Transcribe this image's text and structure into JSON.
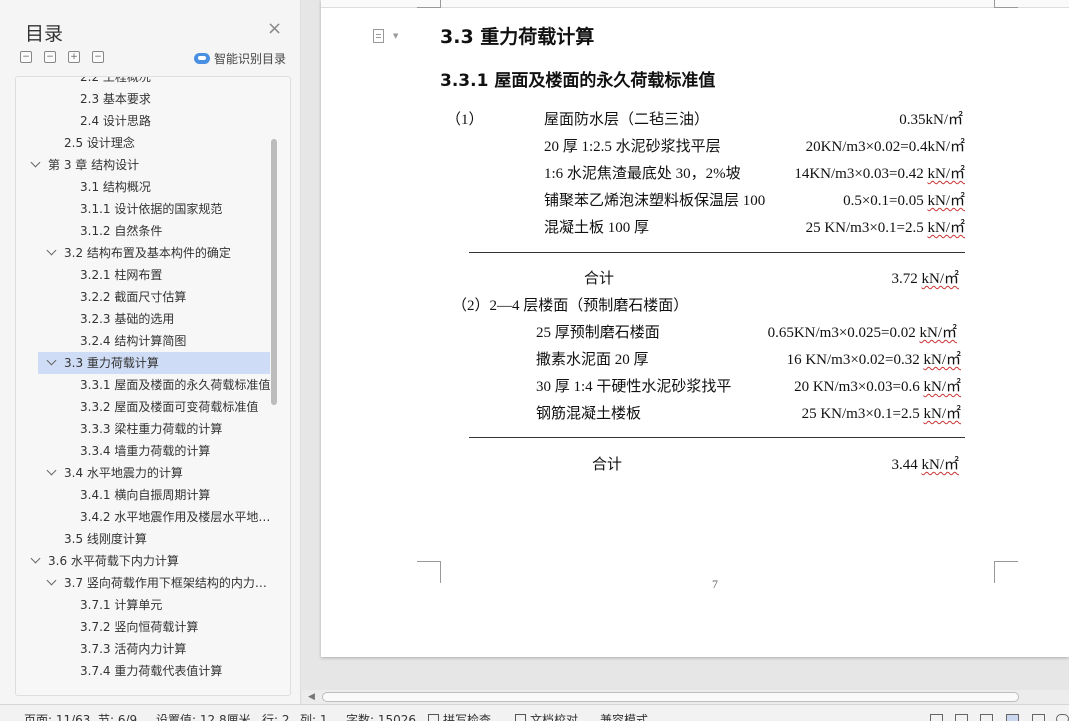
{
  "toc": {
    "title": "目录",
    "close_icon": "×",
    "toolbar": {
      "collapse_all": "−",
      "collapse": "−",
      "expand": "+",
      "expand_all": "−"
    },
    "smart_label": "智能识别目录",
    "items": [
      {
        "label": "2.2 工程概况",
        "level": 2,
        "caret": false
      },
      {
        "label": "2.3 基本要求",
        "level": 2,
        "caret": false
      },
      {
        "label": "2.4 设计思路",
        "level": 2,
        "caret": false
      },
      {
        "label": "2.5 设计理念",
        "level": 1,
        "caret": false
      },
      {
        "label": "第 3 章   结构设计",
        "level": 0,
        "caret": true
      },
      {
        "label": "3.1 结构概况",
        "level": 2,
        "caret": false
      },
      {
        "label": "3.1.1 设计依据的国家规范",
        "level": 2,
        "caret": false
      },
      {
        "label": "3.1.2 自然条件",
        "level": 2,
        "caret": false
      },
      {
        "label": "3.2 结构布置及基本构件的确定",
        "level": 1,
        "caret": true
      },
      {
        "label": "3.2.1 柱网布置",
        "level": 2,
        "caret": false
      },
      {
        "label": "3.2.2 截面尺寸估算",
        "level": 2,
        "caret": false
      },
      {
        "label": "3.2.3 基础的选用",
        "level": 2,
        "caret": false
      },
      {
        "label": "3.2.4 结构计算简图",
        "level": 2,
        "caret": false
      },
      {
        "label": "3.3 重力荷载计算",
        "level": 1,
        "caret": true,
        "selected": true
      },
      {
        "label": "3.3.1 屋面及楼面的永久荷载标准值",
        "level": 2,
        "caret": false
      },
      {
        "label": "3.3.2 屋面及楼面可变荷载标准值",
        "level": 2,
        "caret": false
      },
      {
        "label": "3.3.3 梁柱重力荷载的计算",
        "level": 2,
        "caret": false
      },
      {
        "label": "3.3.4 墙重力荷载的计算",
        "level": 2,
        "caret": false
      },
      {
        "label": "3.4 水平地震力的计算",
        "level": 1,
        "caret": true
      },
      {
        "label": "3.4.1 横向自振周期计算",
        "level": 2,
        "caret": false
      },
      {
        "label": "3.4.2 水平地震作用及楼层水平地震剪力计算",
        "level": 2,
        "caret": false
      },
      {
        "label": "3.5 线刚度计算",
        "level": 1,
        "caret": false
      },
      {
        "label": "3.6 水平荷载下内力计算",
        "level": 0,
        "caret": true
      },
      {
        "label": "3.7 竖向荷载作用下框架结构的内力计算",
        "level": 1,
        "caret": true
      },
      {
        "label": "3.7.1 计算单元",
        "level": 2,
        "caret": false
      },
      {
        "label": "3.7.2 竖向恒荷载计算",
        "level": 2,
        "caret": false
      },
      {
        "label": "3.7.3 活荷内力计算",
        "level": 2,
        "caret": false
      },
      {
        "label": "3.7.4 重力荷载代表值计算",
        "level": 2,
        "caret": false
      }
    ]
  },
  "doc": {
    "heading": "3.3 重力荷载计算",
    "subheading": "3.3.1 屋面及楼面的永久荷载标准值",
    "section1_label": "（1）",
    "roof_rows": [
      {
        "name": "屋面防水层（二毡三油）",
        "calc": "0.35kN/㎡",
        "unit": ""
      },
      {
        "name": "20 厚 1:2.5 水泥砂浆找平层",
        "calc": "20KN/m3×0.02=0.4kN/㎡",
        "unit": ""
      },
      {
        "name": "1:6 水泥焦渣最底处 30，2%坡",
        "calc": "14KN/m3×0.03=0.42 ",
        "unit": "kN/㎡"
      },
      {
        "name": "铺聚苯乙烯泡沫塑料板保温层 100",
        "calc": "0.5×0.1=0.05 ",
        "unit": "kN/㎡"
      },
      {
        "name": "混凝土板 100 厚",
        "calc": "25 KN/m3×0.1=2.5 ",
        "unit": "kN/㎡"
      }
    ],
    "roof_total_label": "合计",
    "roof_total_value": "3.72 ",
    "roof_total_unit": "kN/㎡",
    "section2_label": "（2）2—4 层楼面（预制磨石楼面）",
    "floor_rows": [
      {
        "name": "25 厚预制磨石楼面",
        "calc": "0.65KN/m3×0.025=0.02 ",
        "unit": "kN/㎡"
      },
      {
        "name": "撒素水泥面 20 厚",
        "calc": "16 KN/m3×0.02=0.32 ",
        "unit": "kN/㎡"
      },
      {
        "name": "30 厚 1:4 干硬性水泥砂浆找平",
        "calc": "20 KN/m3×0.03=0.6 ",
        "unit": "kN/㎡"
      },
      {
        "name": "钢筋混凝土楼板",
        "calc": "25 KN/m3×0.1=2.5 ",
        "unit": "kN/㎡"
      }
    ],
    "floor_total_label": "合计",
    "floor_total_value": "3.44 ",
    "floor_total_unit": "kN/㎡",
    "page_number": "7"
  },
  "statusbar": {
    "page": "页面: 11/63",
    "section": "节: 6/9",
    "position": "设置值: 12.8厘米",
    "row": "行: 2",
    "col": "列: 1",
    "words": "字数: 15026",
    "spell_check": "拼写检查",
    "doc_check": "文档校对",
    "compat": "兼容模式"
  }
}
